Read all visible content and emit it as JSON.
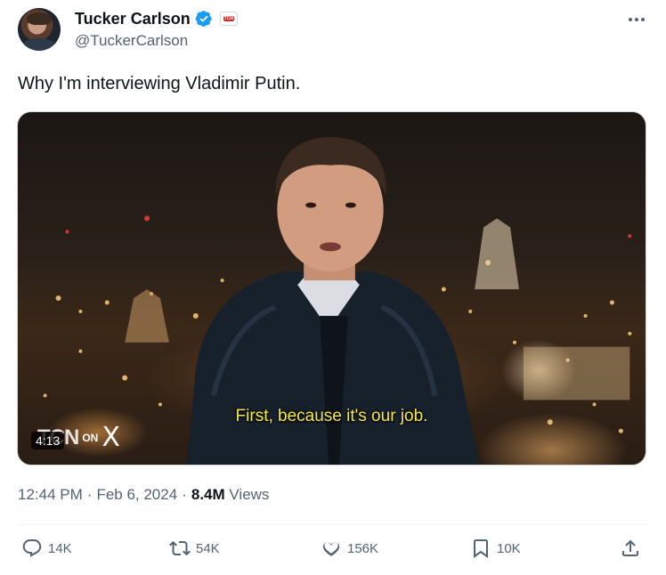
{
  "author": {
    "name": "Tucker Carlson",
    "handle": "@TuckerCarlson",
    "affiliate_badge": "TCN"
  },
  "tweet": {
    "text": "Why I'm interviewing Vladimir Putin."
  },
  "video": {
    "subtitle": "First, because it's our job.",
    "duration": "4:13",
    "brand_mark": "TCN",
    "brand_on": "ON",
    "brand_x": "X"
  },
  "meta": {
    "time": "12:44 PM",
    "separator1": "·",
    "date": "Feb 6, 2024",
    "separator2": "·",
    "views_count": "8.4M",
    "views_label": "Views"
  },
  "actions": {
    "replies": "14K",
    "reposts": "54K",
    "likes": "156K",
    "bookmarks": "10K"
  },
  "colors": {
    "verified": "#1d9bf0",
    "text_primary": "#0f1419",
    "text_secondary": "#536471",
    "subtitle": "#f7e84a"
  },
  "icons": [
    "verified-badge-icon",
    "more-icon",
    "reply-icon",
    "repost-icon",
    "like-icon",
    "bookmark-icon",
    "share-icon"
  ]
}
